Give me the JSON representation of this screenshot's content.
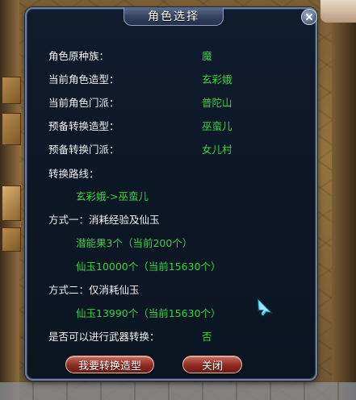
{
  "dialog": {
    "title": "角色选择",
    "fields": [
      {
        "label": "角色原种族：",
        "value": "魔"
      },
      {
        "label": "当前角色造型：",
        "value": "玄彩娥"
      },
      {
        "label": "当前角色门派：",
        "value": "普陀山"
      },
      {
        "label": "预备转换造型：",
        "value": "巫蛮儿"
      },
      {
        "label": "预备转换门派：",
        "value": "女儿村"
      }
    ],
    "route": {
      "label": "转换路线：",
      "value": "玄彩娥->巫蛮儿"
    },
    "method_one": {
      "label": "方式一：消耗经验及仙玉",
      "items": [
        "潜能果3个（当前200个）",
        "仙玉10000个（当前15630个）"
      ]
    },
    "method_two": {
      "label": "方式二：仅消耗仙玉",
      "items": [
        "仙玉13990个（当前15630个）"
      ]
    },
    "weapon": {
      "label": "是否可以进行武器转换：",
      "value": "否"
    },
    "buttons": {
      "transform": "我要转换造型",
      "close": "关闭"
    }
  },
  "icons": {
    "close": "close-icon",
    "cursor": "pointer-cursor-icon"
  },
  "colors": {
    "label_text": "#f2f2f2",
    "value_text": "#39d146",
    "panel_bg": "#0c1726",
    "button_red": "#8e2b22"
  }
}
